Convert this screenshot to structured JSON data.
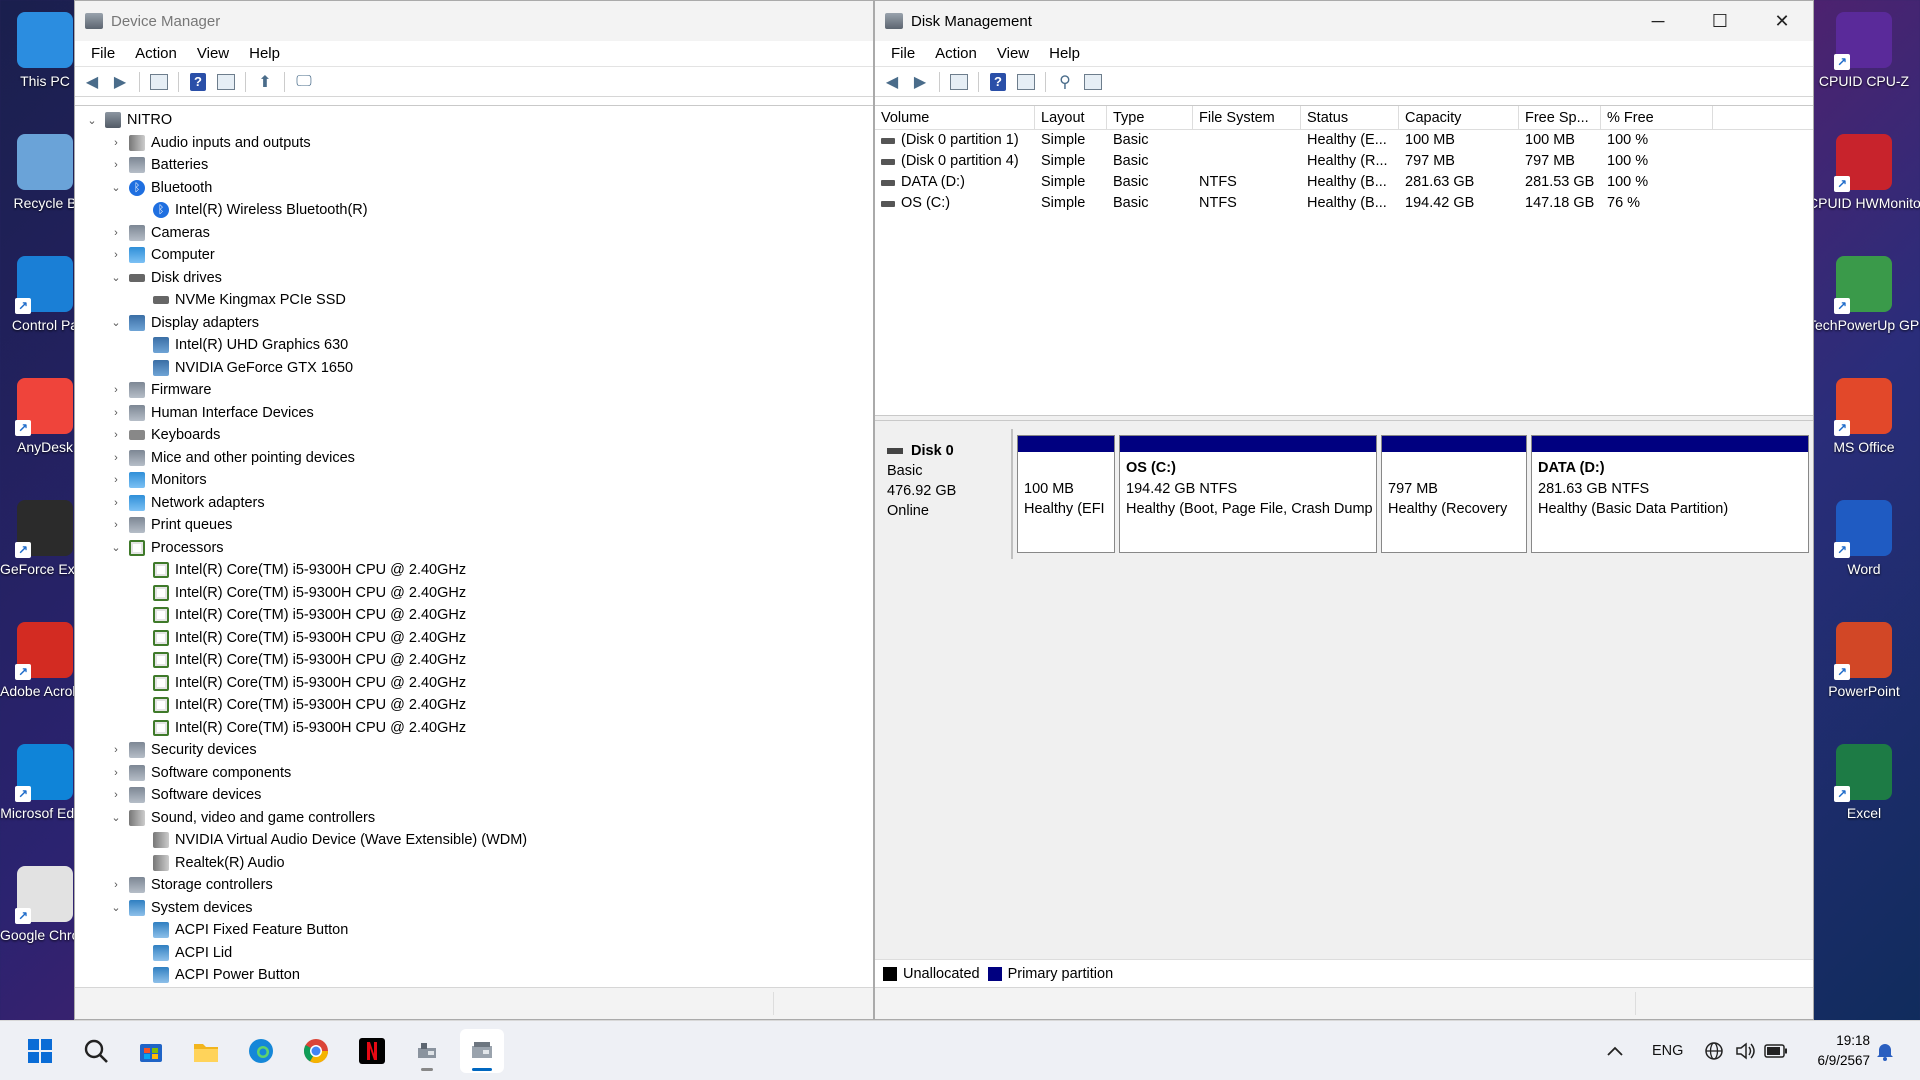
{
  "desktop_left": [
    {
      "label": "This PC",
      "icon": "monitor-icon",
      "color": "#2b8de0"
    },
    {
      "label": "Recycle B",
      "icon": "recycle-bin-icon",
      "color": "#6aa3d8"
    },
    {
      "label": "Control Pa",
      "icon": "control-panel-icon",
      "color": "#1a7fd6"
    },
    {
      "label": "AnyDesk",
      "icon": "anydesk-icon",
      "color": "#ef443b"
    },
    {
      "label": "GeForce Experien",
      "icon": "geforce-icon",
      "color": "#2b2b2b"
    },
    {
      "label": "Adobe Acrobat D",
      "icon": "acrobat-icon",
      "color": "#d32b22"
    },
    {
      "label": "Microsof Edge",
      "icon": "edge-icon",
      "color": "#0f84d8"
    },
    {
      "label": "Google Chrome",
      "icon": "chrome-icon",
      "color": "#e2e2e2"
    }
  ],
  "desktop_right": [
    {
      "label": "CPUID CPU-Z",
      "icon": "cpuz-icon",
      "color": "#5a2a9a"
    },
    {
      "label": "CPUID HWMonitor",
      "icon": "hwmonitor-icon",
      "color": "#c8232c"
    },
    {
      "label": "TechPowerUp GPU-Z",
      "icon": "gpuz-icon",
      "color": "#3a9a4a"
    },
    {
      "label": "MS Office",
      "icon": "office-icon",
      "color": "#e2482a"
    },
    {
      "label": "Word",
      "icon": "word-icon",
      "color": "#1f5bc2"
    },
    {
      "label": "PowerPoint",
      "icon": "powerpoint-icon",
      "color": "#d24726"
    },
    {
      "label": "Excel",
      "icon": "excel-icon",
      "color": "#1d7b45"
    }
  ],
  "device_manager": {
    "title": "Device Manager",
    "menu": [
      "File",
      "Action",
      "View",
      "Help"
    ],
    "tree": [
      {
        "label": "NITRO",
        "level": 0,
        "state": "open",
        "icon": "root"
      },
      {
        "label": "Audio inputs and outputs",
        "level": 1,
        "state": "closed",
        "icon": "snd"
      },
      {
        "label": "Batteries",
        "level": 1,
        "state": "closed",
        "icon": "gen"
      },
      {
        "label": "Bluetooth",
        "level": 1,
        "state": "open",
        "icon": "bt"
      },
      {
        "label": "Intel(R) Wireless Bluetooth(R)",
        "level": 2,
        "state": "leaf",
        "icon": "bt"
      },
      {
        "label": "Cameras",
        "level": 1,
        "state": "closed",
        "icon": "gen"
      },
      {
        "label": "Computer",
        "level": 1,
        "state": "closed",
        "icon": "mon"
      },
      {
        "label": "Disk drives",
        "level": 1,
        "state": "open",
        "icon": "disk"
      },
      {
        "label": "NVMe Kingmax PCIe SSD",
        "level": 2,
        "state": "leaf",
        "icon": "disk"
      },
      {
        "label": "Display adapters",
        "level": 1,
        "state": "open",
        "icon": "gpu"
      },
      {
        "label": "Intel(R) UHD Graphics 630",
        "level": 2,
        "state": "leaf",
        "icon": "gpu"
      },
      {
        "label": "NVIDIA GeForce GTX 1650",
        "level": 2,
        "state": "leaf",
        "icon": "gpu"
      },
      {
        "label": "Firmware",
        "level": 1,
        "state": "closed",
        "icon": "gen"
      },
      {
        "label": "Human Interface Devices",
        "level": 1,
        "state": "closed",
        "icon": "gen"
      },
      {
        "label": "Keyboards",
        "level": 1,
        "state": "closed",
        "icon": "kb"
      },
      {
        "label": "Mice and other pointing devices",
        "level": 1,
        "state": "closed",
        "icon": "gen"
      },
      {
        "label": "Monitors",
        "level": 1,
        "state": "closed",
        "icon": "mon"
      },
      {
        "label": "Network adapters",
        "level": 1,
        "state": "closed",
        "icon": "mon"
      },
      {
        "label": "Print queues",
        "level": 1,
        "state": "closed",
        "icon": "gen"
      },
      {
        "label": "Processors",
        "level": 1,
        "state": "open",
        "icon": "cpu"
      },
      {
        "label": "Intel(R) Core(TM) i5-9300H CPU @ 2.40GHz",
        "level": 2,
        "state": "leaf",
        "icon": "cpu"
      },
      {
        "label": "Intel(R) Core(TM) i5-9300H CPU @ 2.40GHz",
        "level": 2,
        "state": "leaf",
        "icon": "cpu"
      },
      {
        "label": "Intel(R) Core(TM) i5-9300H CPU @ 2.40GHz",
        "level": 2,
        "state": "leaf",
        "icon": "cpu"
      },
      {
        "label": "Intel(R) Core(TM) i5-9300H CPU @ 2.40GHz",
        "level": 2,
        "state": "leaf",
        "icon": "cpu"
      },
      {
        "label": "Intel(R) Core(TM) i5-9300H CPU @ 2.40GHz",
        "level": 2,
        "state": "leaf",
        "icon": "cpu"
      },
      {
        "label": "Intel(R) Core(TM) i5-9300H CPU @ 2.40GHz",
        "level": 2,
        "state": "leaf",
        "icon": "cpu"
      },
      {
        "label": "Intel(R) Core(TM) i5-9300H CPU @ 2.40GHz",
        "level": 2,
        "state": "leaf",
        "icon": "cpu"
      },
      {
        "label": "Intel(R) Core(TM) i5-9300H CPU @ 2.40GHz",
        "level": 2,
        "state": "leaf",
        "icon": "cpu"
      },
      {
        "label": "Security devices",
        "level": 1,
        "state": "closed",
        "icon": "gen"
      },
      {
        "label": "Software components",
        "level": 1,
        "state": "closed",
        "icon": "gen"
      },
      {
        "label": "Software devices",
        "level": 1,
        "state": "closed",
        "icon": "gen"
      },
      {
        "label": "Sound, video and game controllers",
        "level": 1,
        "state": "open",
        "icon": "snd"
      },
      {
        "label": "NVIDIA Virtual Audio Device (Wave Extensible) (WDM)",
        "level": 2,
        "state": "leaf",
        "icon": "snd"
      },
      {
        "label": "Realtek(R) Audio",
        "level": 2,
        "state": "leaf",
        "icon": "snd"
      },
      {
        "label": "Storage controllers",
        "level": 1,
        "state": "closed",
        "icon": "gen"
      },
      {
        "label": "System devices",
        "level": 1,
        "state": "open",
        "icon": "sys"
      },
      {
        "label": "ACPI Fixed Feature Button",
        "level": 2,
        "state": "leaf",
        "icon": "sys"
      },
      {
        "label": "ACPI Lid",
        "level": 2,
        "state": "leaf",
        "icon": "sys"
      },
      {
        "label": "ACPI Power Button",
        "level": 2,
        "state": "leaf",
        "icon": "sys"
      }
    ]
  },
  "disk_management": {
    "title": "Disk Management",
    "menu": [
      "File",
      "Action",
      "View",
      "Help"
    ],
    "columns": [
      "Volume",
      "Layout",
      "Type",
      "File System",
      "Status",
      "Capacity",
      "Free Sp...",
      "% Free"
    ],
    "rows": [
      [
        "(Disk 0 partition 1)",
        "Simple",
        "Basic",
        "",
        "Healthy (E...",
        "100 MB",
        "100 MB",
        "100 %"
      ],
      [
        "(Disk 0 partition 4)",
        "Simple",
        "Basic",
        "",
        "Healthy (R...",
        "797 MB",
        "797 MB",
        "100 %"
      ],
      [
        "DATA (D:)",
        "Simple",
        "Basic",
        "NTFS",
        "Healthy (B...",
        "281.63 GB",
        "281.53 GB",
        "100 %"
      ],
      [
        "OS (C:)",
        "Simple",
        "Basic",
        "NTFS",
        "Healthy (B...",
        "194.42 GB",
        "147.18 GB",
        "76 %"
      ]
    ],
    "disk": {
      "name": "Disk 0",
      "type": "Basic",
      "size": "476.92 GB",
      "status": "Online",
      "partitions": [
        {
          "name": "",
          "size": "100 MB",
          "status": "Healthy (EFI"
        },
        {
          "name": "OS  (C:)",
          "size": "194.42 GB NTFS",
          "status": "Healthy (Boot, Page File, Crash Dump"
        },
        {
          "name": "",
          "size": "797 MB",
          "status": "Healthy (Recovery"
        },
        {
          "name": "DATA  (D:)",
          "size": "281.63 GB NTFS",
          "status": "Healthy (Basic Data Partition)"
        }
      ]
    },
    "legend": [
      {
        "label": "Unallocated",
        "color": "#000000"
      },
      {
        "label": "Primary partition",
        "color": "#000080"
      }
    ]
  },
  "taskbar": {
    "apps": [
      "start-icon",
      "search-icon",
      "store-icon",
      "file-explorer-icon",
      "edge-icon",
      "chrome-icon",
      "netflix-icon",
      "device-manager-icon",
      "disk-management-icon"
    ],
    "language": "ENG",
    "time": "19:18",
    "date": "6/9/2567"
  }
}
